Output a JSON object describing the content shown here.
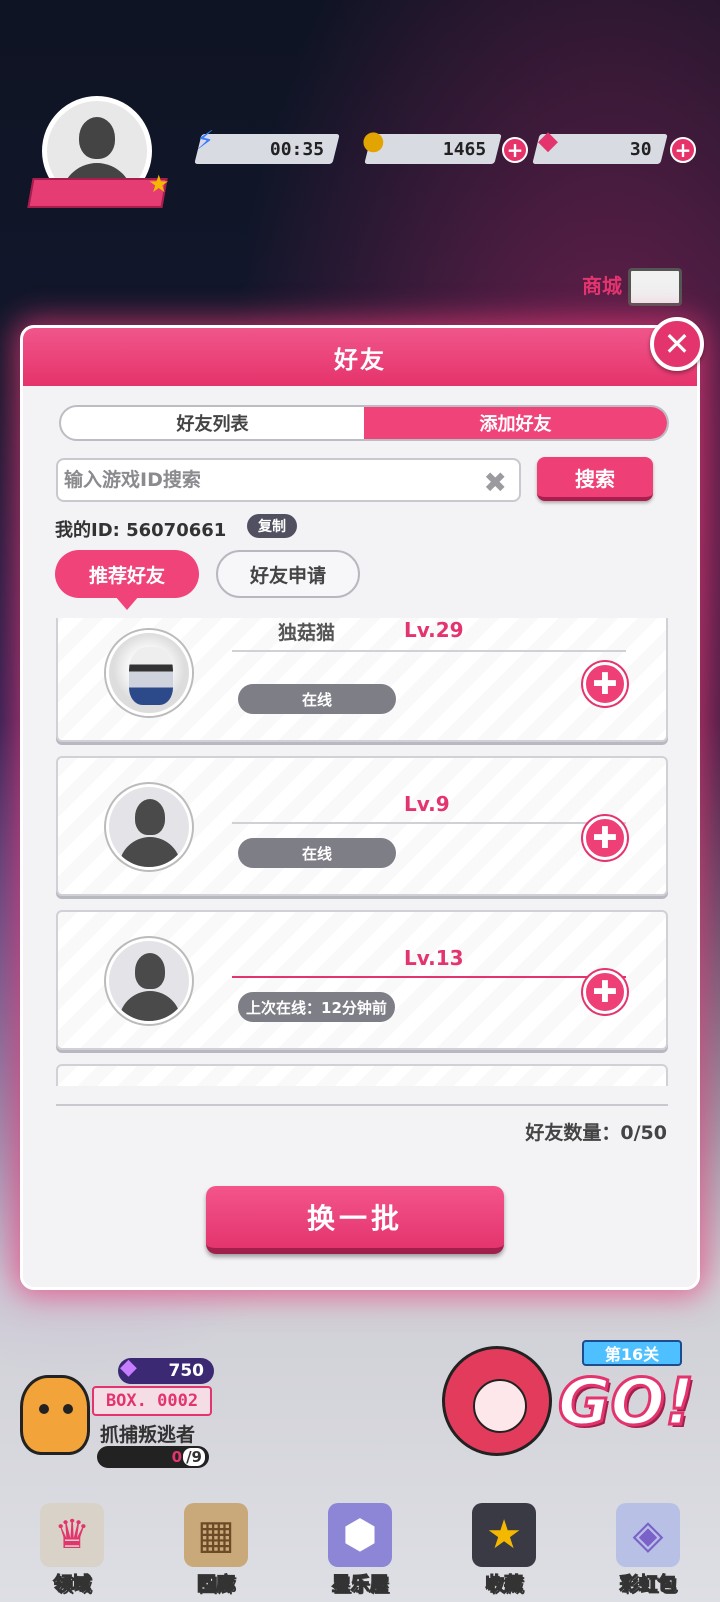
{
  "hud": {
    "energy_timer": "00:35",
    "coins": "1465",
    "gems": "30",
    "shop_label": "商城"
  },
  "modal": {
    "title": "好友",
    "tabs": [
      "好友列表",
      "添加好友"
    ],
    "active_tab": "添加好友",
    "search": {
      "placeholder": "输入游戏ID搜索",
      "button_label": "搜索"
    },
    "my_id_label": "我的ID: 56070661",
    "copy_label": "复制",
    "subtabs": [
      "推荐好友",
      "好友申请"
    ],
    "friends": [
      {
        "name": "独菇猫",
        "level": "Lv.29",
        "status": "在线",
        "avatar": "character-avatar"
      },
      {
        "name": "",
        "level": "Lv.9",
        "status": "在线",
        "avatar": "default-avatar"
      },
      {
        "name": "",
        "level": "Lv.13",
        "status": "上次在线：12分钟前",
        "avatar": "default-avatar"
      }
    ],
    "friend_count": "好友数量：0/50",
    "refresh_label": "换一批"
  },
  "bottom": {
    "gem_count": "750",
    "box_code": "BOX. 0002",
    "escape_title": "抓捕叛逃者",
    "progress_current": "0",
    "progress_total": "/9",
    "level_tag": "第16关",
    "go_label": "GO!"
  },
  "nav": [
    {
      "label": "领域",
      "icon": "domain-icon"
    },
    {
      "label": "回廊",
      "icon": "gallery-icon"
    },
    {
      "label": "星乐屋",
      "icon": "star-house-icon"
    },
    {
      "label": "收藏",
      "icon": "collection-star-icon"
    },
    {
      "label": "彩虹包",
      "icon": "rainbow-pack-icon"
    }
  ],
  "colors": {
    "accent": "#e4346e",
    "panel": "#f3f3f5",
    "status_gray": "#7e7e86"
  }
}
